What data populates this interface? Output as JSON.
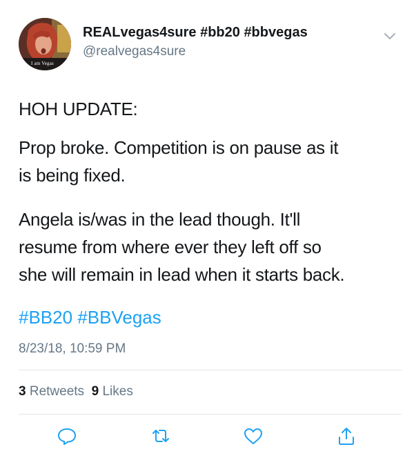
{
  "tweet": {
    "display_name": "REALvegas4sure #bb20 #bbvegas",
    "handle": "@realvegas4sure",
    "avatar_caption": "I am Vegas",
    "paragraphs": [
      {
        "lines": [
          "HOH UPDATE:"
        ]
      },
      {
        "lines": [
          "Prop broke. Competition is on pause as it",
          "is being fixed."
        ]
      },
      {
        "lines": [
          "Angela is/was in the lead though. It'll",
          "resume from where ever they left off so",
          "she will remain in lead when it starts back."
        ]
      }
    ],
    "hashtags": [
      "#BB20",
      "#BBVegas"
    ],
    "timestamp": "8/23/18, 10:59 PM",
    "stats": {
      "retweets_count": "3",
      "retweets_label": "Retweets",
      "likes_count": "9",
      "likes_label": "Likes"
    }
  },
  "actions": [
    {
      "name": "reply",
      "icon": "reply-icon"
    },
    {
      "name": "retweet",
      "icon": "retweet-icon"
    },
    {
      "name": "like",
      "icon": "heart-icon"
    },
    {
      "name": "share",
      "icon": "share-icon"
    }
  ],
  "colors": {
    "text": "#14171a",
    "secondary": "#657786",
    "link": "#1da1f2",
    "divider": "#e1e8ed"
  }
}
